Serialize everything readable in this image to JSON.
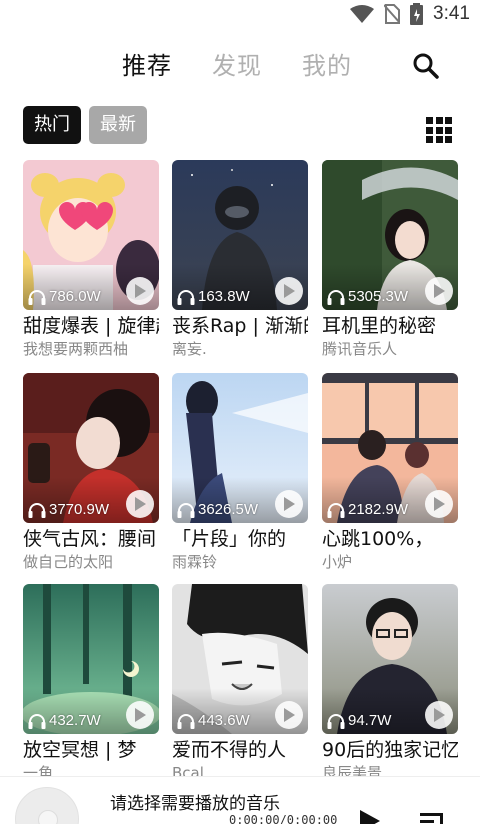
{
  "status_bar": {
    "time": "3:41"
  },
  "nav": {
    "tabs": [
      {
        "label": "推荐",
        "active": true
      },
      {
        "label": "发现",
        "active": false
      },
      {
        "label": "我的",
        "active": false
      }
    ]
  },
  "filters": [
    {
      "label": "热门",
      "active": true
    },
    {
      "label": "最新",
      "active": false
    }
  ],
  "playlists": [
    {
      "plays": "786.0W",
      "title": "甜度爆表 | 旋律超甜的二次元",
      "author": "我想要两颗西柚"
    },
    {
      "plays": "163.8W",
      "title": "丧系Rap | 渐渐的",
      "author": "离妄."
    },
    {
      "plays": "5305.3W",
      "title": "耳机里的秘密",
      "author": "腾讯音乐人"
    },
    {
      "plays": "3770.9W",
      "title": "侠气古风：腰间",
      "author": "做自己的太阳"
    },
    {
      "plays": "3626.5W",
      "title": "「片段」你的",
      "author": "雨霖铃"
    },
    {
      "plays": "2182.9W",
      "title": "心跳100%，",
      "author": "小炉"
    },
    {
      "plays": "432.7W",
      "title": "放空冥想 | 梦",
      "author": "一角"
    },
    {
      "plays": "443.6W",
      "title": "爱而不得的人",
      "author": "Bcal"
    },
    {
      "plays": "94.7W",
      "title": "90后的独家记忆",
      "author": "良辰美景"
    }
  ],
  "player": {
    "title": "请选择需要播放的音乐",
    "time": "0:00:00/0:00:00"
  },
  "colors": {
    "accent": "#111111",
    "inactive_text": "#b0b0b0",
    "chip_inactive": "#a8a8a8"
  }
}
